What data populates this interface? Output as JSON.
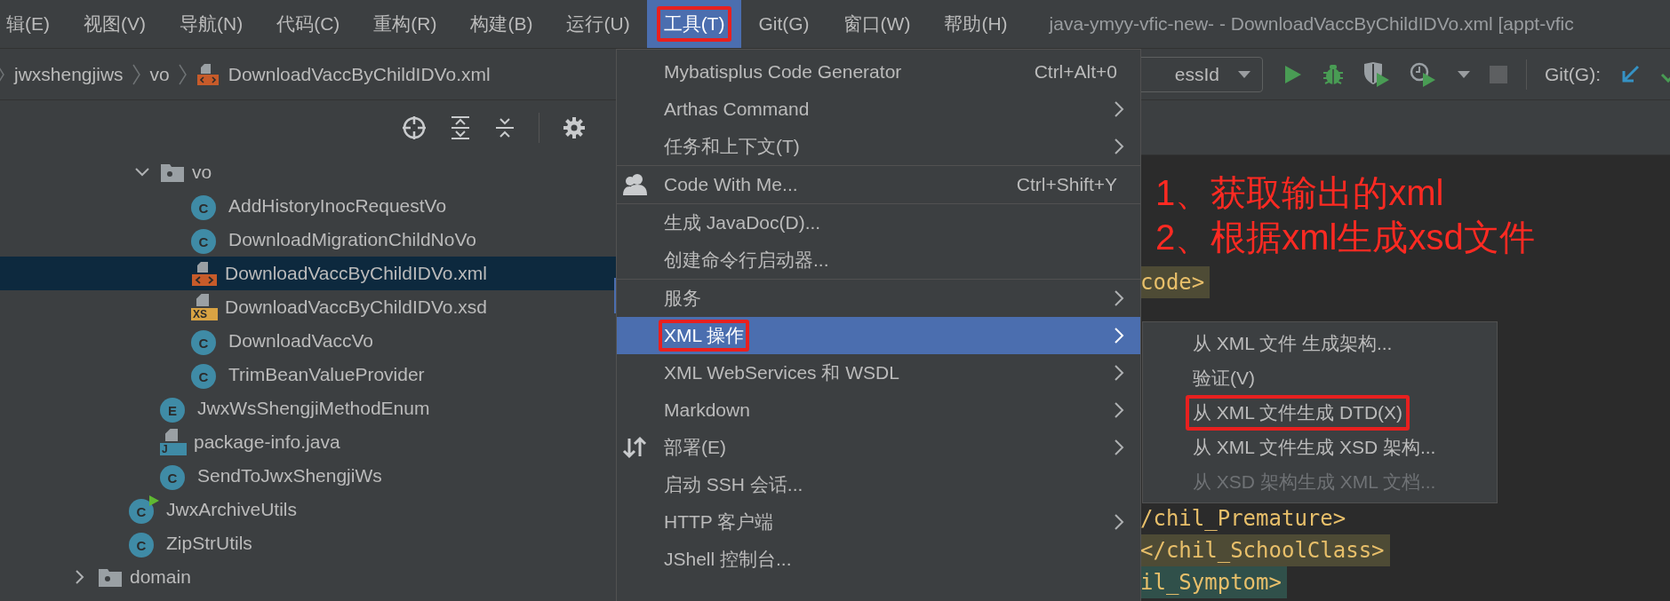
{
  "window": {
    "title": "java-ymyy-vfic-new- - DownloadVaccByChildIDVo.xml [appt-vfic"
  },
  "menubar": [
    {
      "label": "辑(E)",
      "selected": false,
      "annotated": false
    },
    {
      "label": "视图(V)",
      "selected": false,
      "annotated": false
    },
    {
      "label": "导航(N)",
      "selected": false,
      "annotated": false
    },
    {
      "label": "代码(C)",
      "selected": false,
      "annotated": false
    },
    {
      "label": "重构(R)",
      "selected": false,
      "annotated": false
    },
    {
      "label": "构建(B)",
      "selected": false,
      "annotated": false
    },
    {
      "label": "运行(U)",
      "selected": false,
      "annotated": false
    },
    {
      "label": "工具(T)",
      "selected": true,
      "annotated": true
    },
    {
      "label": "Git(G)",
      "selected": false,
      "annotated": false
    },
    {
      "label": "窗口(W)",
      "selected": false,
      "annotated": false
    },
    {
      "label": "帮助(H)",
      "selected": false,
      "annotated": false
    }
  ],
  "breadcrumb": [
    {
      "label": "jwxshengjiws",
      "kind": "folder"
    },
    {
      "label": "vo",
      "kind": "folder"
    },
    {
      "label": "DownloadVaccByChildIDVo.xml",
      "kind": "xml"
    }
  ],
  "run_toolbar": {
    "config_dropdown": "essId",
    "git_label": "Git(G):"
  },
  "project_tree": [
    {
      "children": [
        {
          "children": [
            {
              "label": "vo",
              "kind": "folder",
              "expanded": true,
              "selected": false,
              "children": [
                {
                  "label": "AddHistoryInocRequestVo",
                  "kind": "class",
                  "badge": "C",
                  "selected": false
                },
                {
                  "label": "DownloadMigrationChildNoVo",
                  "kind": "class",
                  "badge": "C",
                  "selected": false
                },
                {
                  "label": "DownloadVaccByChildIDVo.xml",
                  "kind": "xml",
                  "selected": true
                },
                {
                  "label": "DownloadVaccByChildIDVo.xsd",
                  "kind": "xsd",
                  "badge": "XS",
                  "selected": false
                },
                {
                  "label": "DownloadVaccVo",
                  "kind": "class",
                  "badge": "C",
                  "selected": false
                },
                {
                  "label": "TrimBeanValueProvider",
                  "kind": "class",
                  "badge": "C",
                  "selected": false
                }
              ]
            },
            {
              "label": "JwxWsShengjiMethodEnum",
              "kind": "class",
              "badge": "E",
              "selected": false
            },
            {
              "label": "package-info.java",
              "kind": "java",
              "badge": "J",
              "selected": false
            },
            {
              "label": "SendToJwxShengjiWs",
              "kind": "class",
              "badge": "C",
              "selected": false
            }
          ]
        },
        {
          "label": "JwxArchiveUtils",
          "kind": "class-main",
          "badge": "C",
          "selected": false
        },
        {
          "label": "ZipStrUtils",
          "kind": "class",
          "badge": "C",
          "selected": false
        }
      ]
    },
    {
      "label": "domain",
      "kind": "folder",
      "expanded": false,
      "selected": false
    }
  ],
  "editor": {
    "lines": [
      {
        "text": "code>",
        "color": "#4e4b35"
      },
      {
        "text": "/chil_Premature>"
      },
      {
        "text": "</chil_SchoolClass>",
        "color": "#4e4b35"
      },
      {
        "text": "il_Symptom>",
        "color": "#30504a"
      }
    ]
  },
  "tools_menu": [
    {
      "kind": "item",
      "label": "Mybatisplus Code Generator",
      "shortcut": "Ctrl+Alt+0",
      "submenu": false,
      "selected": false,
      "annotated": false
    },
    {
      "kind": "item",
      "label": "Arthas Command",
      "submenu": true,
      "selected": false,
      "annotated": false
    },
    {
      "kind": "item",
      "label": "任务和上下文(T)",
      "submenu": true,
      "selected": false,
      "annotated": false
    },
    {
      "kind": "separator"
    },
    {
      "kind": "collab",
      "label": "Code With Me...",
      "shortcut": "Ctrl+Shift+Y",
      "submenu": false,
      "selected": false,
      "annotated": false
    },
    {
      "kind": "separator"
    },
    {
      "kind": "item",
      "label": "生成 JavaDoc(D)...",
      "submenu": false,
      "selected": false,
      "annotated": false
    },
    {
      "kind": "item",
      "label": "创建命令行启动器...",
      "submenu": false,
      "selected": false,
      "annotated": false
    },
    {
      "kind": "separator"
    },
    {
      "kind": "item",
      "label": "服务",
      "submenu": true,
      "selected": false,
      "annotated": false
    },
    {
      "kind": "item",
      "label": "XML 操作",
      "submenu": true,
      "selected": true,
      "annotated": true
    },
    {
      "kind": "item",
      "label": "XML WebServices 和 WSDL",
      "submenu": true,
      "selected": false,
      "annotated": false
    },
    {
      "kind": "item",
      "label": "Markdown",
      "submenu": true,
      "selected": false,
      "annotated": false
    },
    {
      "kind": "deploy",
      "label": "部署(E)",
      "submenu": true,
      "selected": false,
      "annotated": false
    },
    {
      "kind": "item",
      "label": "启动 SSH 会话...",
      "submenu": false,
      "selected": false,
      "annotated": false
    },
    {
      "kind": "item",
      "label": "HTTP 客户端",
      "submenu": true,
      "selected": false,
      "annotated": false
    },
    {
      "kind": "item",
      "label": "JShell 控制台...",
      "submenu": false,
      "selected": false,
      "annotated": false
    }
  ],
  "xml_submenu": [
    {
      "label": "从 XML 文件 生成架构...",
      "disabled": false,
      "annotated": false
    },
    {
      "label": "验证(V)",
      "disabled": false,
      "annotated": false
    },
    {
      "label": "从 XML 文件生成 DTD(X)",
      "disabled": false,
      "annotated": true
    },
    {
      "label": "从 XML 文件生成 XSD 架构...",
      "disabled": false,
      "annotated": false
    },
    {
      "label": "从 XSD 架构生成 XML 文档...",
      "disabled": true,
      "annotated": false
    }
  ],
  "annotations": [
    "1、获取输出的xml",
    "2、根据xml生成xsd文件"
  ]
}
